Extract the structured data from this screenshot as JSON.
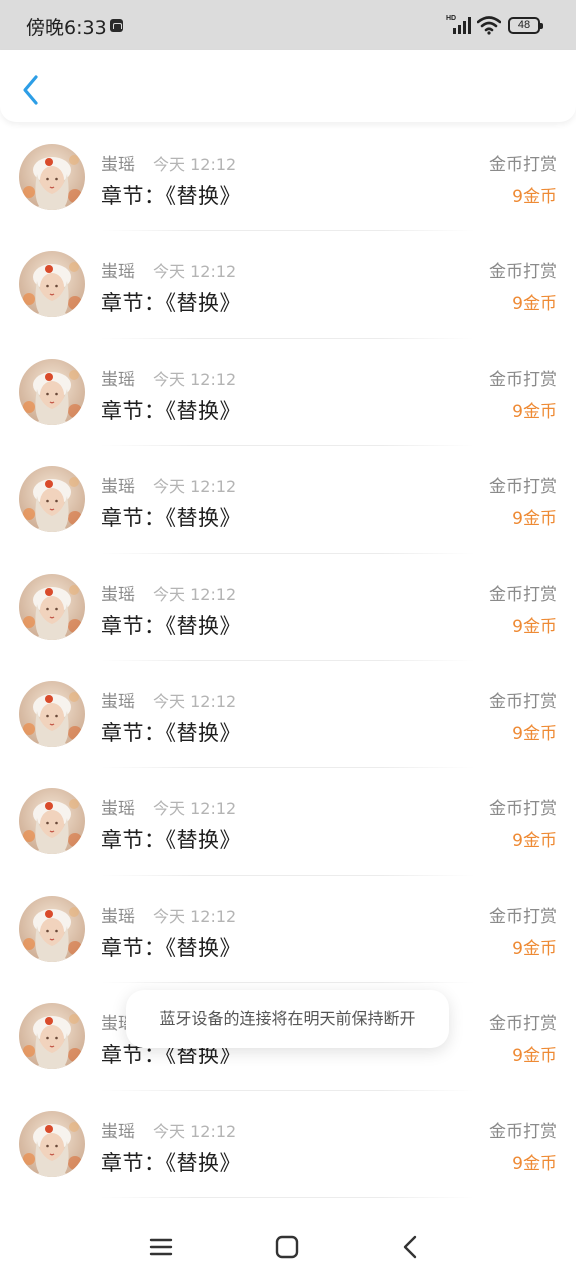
{
  "status_bar": {
    "time": "傍晚6:33",
    "hd_label": "HD",
    "battery": "48"
  },
  "header": {
    "back_icon": "chevron-left-icon",
    "accent_color": "#2d9ee6"
  },
  "items": [
    {
      "user": "蚩瑶",
      "time": "今天 12:12",
      "chapter": "章节：《替换》",
      "reward_type": "金币打赏",
      "reward_amount": "9金币"
    },
    {
      "user": "蚩瑶",
      "time": "今天 12:12",
      "chapter": "章节：《替换》",
      "reward_type": "金币打赏",
      "reward_amount": "9金币"
    },
    {
      "user": "蚩瑶",
      "time": "今天 12:12",
      "chapter": "章节：《替换》",
      "reward_type": "金币打赏",
      "reward_amount": "9金币"
    },
    {
      "user": "蚩瑶",
      "time": "今天 12:12",
      "chapter": "章节：《替换》",
      "reward_type": "金币打赏",
      "reward_amount": "9金币"
    },
    {
      "user": "蚩瑶",
      "time": "今天 12:12",
      "chapter": "章节：《替换》",
      "reward_type": "金币打赏",
      "reward_amount": "9金币"
    },
    {
      "user": "蚩瑶",
      "time": "今天 12:12",
      "chapter": "章节：《替换》",
      "reward_type": "金币打赏",
      "reward_amount": "9金币"
    },
    {
      "user": "蚩瑶",
      "time": "今天 12:12",
      "chapter": "章节：《替换》",
      "reward_type": "金币打赏",
      "reward_amount": "9金币"
    },
    {
      "user": "蚩瑶",
      "time": "今天 12:12",
      "chapter": "章节：《替换》",
      "reward_type": "金币打赏",
      "reward_amount": "9金币"
    },
    {
      "user": "蚩瑶",
      "time": "今天 12:12",
      "chapter": "章节：《替换》",
      "reward_type": "金币打赏",
      "reward_amount": "9金币"
    },
    {
      "user": "蚩瑶",
      "time": "今天 12:12",
      "chapter": "章节：《替换》",
      "reward_type": "金币打赏",
      "reward_amount": "9金币"
    }
  ],
  "toast": "蓝牙设备的连接将在明天前保持断开",
  "colors": {
    "reward_amount": "#ee8a34",
    "secondary_text": "#8a8a8a",
    "primary_text": "#1f1f1f"
  },
  "nav_bar": {
    "menu_icon": "menu-icon",
    "home_icon": "home-icon",
    "back_icon": "back-icon"
  }
}
